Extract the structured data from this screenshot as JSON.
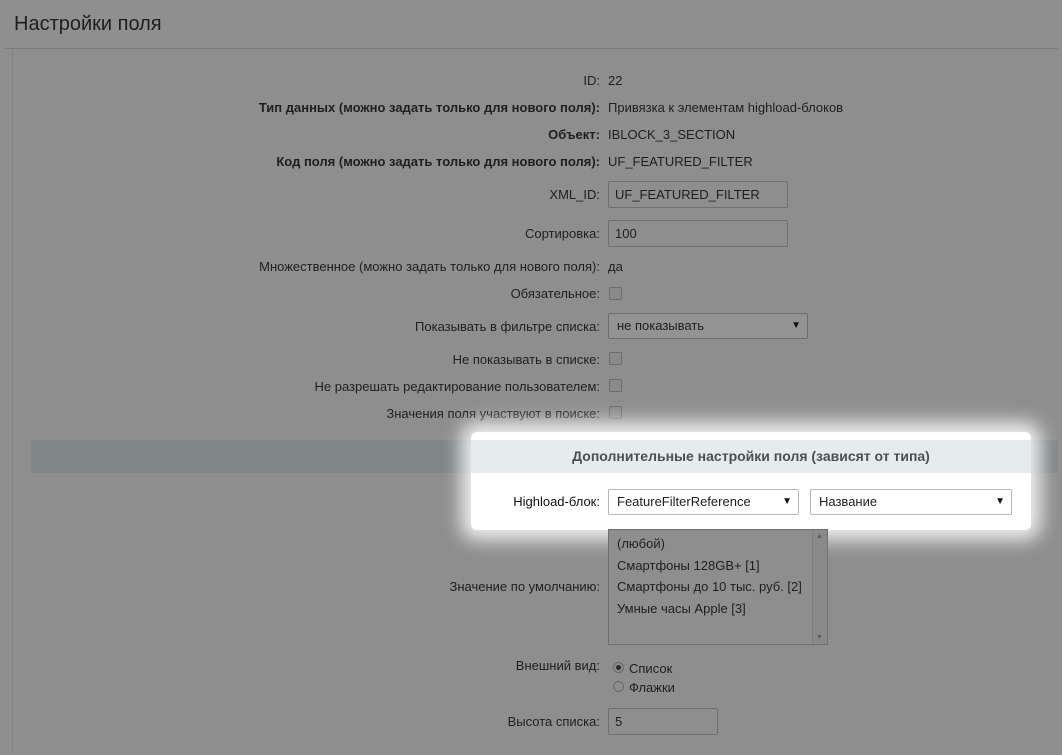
{
  "page_title": "Настройки поля",
  "fields": {
    "id": {
      "label": "ID:",
      "value": "22"
    },
    "data_type": {
      "label": "Тип данных (можно задать только для нового поля):",
      "value": "Привязка к элементам highload-блоков"
    },
    "object": {
      "label": "Объект:",
      "value": "IBLOCK_3_SECTION"
    },
    "field_code": {
      "label": "Код поля (можно задать только для нового поля):",
      "value": "UF_FEATURED_FILTER"
    },
    "xml_id": {
      "label": "XML_ID:",
      "value": "UF_FEATURED_FILTER"
    },
    "sort": {
      "label": "Сортировка:",
      "value": "100"
    },
    "multiple": {
      "label": "Множественное (можно задать только для нового поля):",
      "value": "да"
    },
    "required": {
      "label": "Обязательное:",
      "checked": false
    },
    "show_filter": {
      "label": "Показывать в фильтре списка:",
      "value": "не показывать"
    },
    "hide_in_list": {
      "label": "Не показывать в списке:",
      "checked": false
    },
    "no_user_edit": {
      "label": "Не разрешать редактирование пользователем:",
      "checked": false
    },
    "searchable": {
      "label": "Значения поля участвуют в поиске:",
      "checked": false
    }
  },
  "extra_section": {
    "title": "Дополнительные настройки поля (зависят от типа)",
    "hlblock": {
      "label": "Highload-блок:",
      "block_value": "FeatureFilterReference",
      "field_value": "Название"
    },
    "default_value": {
      "label": "Значение по умолчанию:",
      "options": [
        "(любой)",
        "Смартфоны 128GB+ [1]",
        "Смартфоны до 10 тыс. руб. [2]",
        "Умные часы Apple [3]"
      ]
    },
    "view": {
      "label": "Внешний вид:",
      "options": [
        "Список",
        "Флажки"
      ],
      "selected": "Список"
    },
    "list_height": {
      "label": "Высота списка:",
      "value": "5"
    }
  },
  "icons": {
    "dropdown": "chevron-down-icon",
    "scroll_up": "scroll-up-icon",
    "scroll_down": "scroll-down-icon"
  }
}
